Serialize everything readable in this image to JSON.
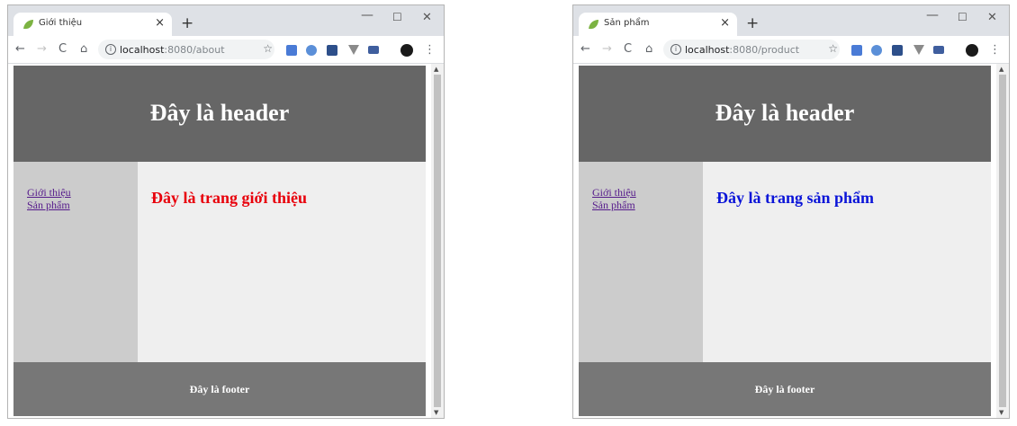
{
  "windows": [
    {
      "tab_title": "Giới thiệu",
      "url_host": "localhost",
      "url_path": ":8080/about",
      "header_text": "Đây là header",
      "nav_links": [
        "Giới thiệu",
        "Sản phẩm"
      ],
      "content_heading": "Đây là trang giới thiệu",
      "content_color": "#e8000b",
      "footer_text": "Đây là footer"
    },
    {
      "tab_title": "Sản phẩm",
      "url_host": "localhost",
      "url_path": ":8080/product",
      "header_text": "Đây là header",
      "nav_links": [
        "Giới thiệu",
        "Sản phẩm"
      ],
      "content_heading": "Đây là trang sản phẩm",
      "content_color": "#0a14d8",
      "footer_text": "Đây là footer"
    }
  ],
  "browser": {
    "close_tab_glyph": "×",
    "new_tab_glyph": "+",
    "minimize_glyph": "—",
    "maximize_glyph": "☐",
    "close_window_glyph": "✕",
    "back_glyph": "←",
    "forward_glyph": "→",
    "reload_glyph": "C",
    "home_glyph": "⌂",
    "info_glyph": "i",
    "star_glyph": "☆",
    "menu_glyph": "⋮",
    "favicon_color": "#7cb342",
    "icons": [
      "leaf-favicon-icon",
      "arrow-left-icon",
      "arrow-right-icon",
      "reload-icon",
      "home-icon",
      "info-icon",
      "star-icon",
      "extension-icon",
      "avatar-icon",
      "kebab-menu-icon"
    ]
  }
}
